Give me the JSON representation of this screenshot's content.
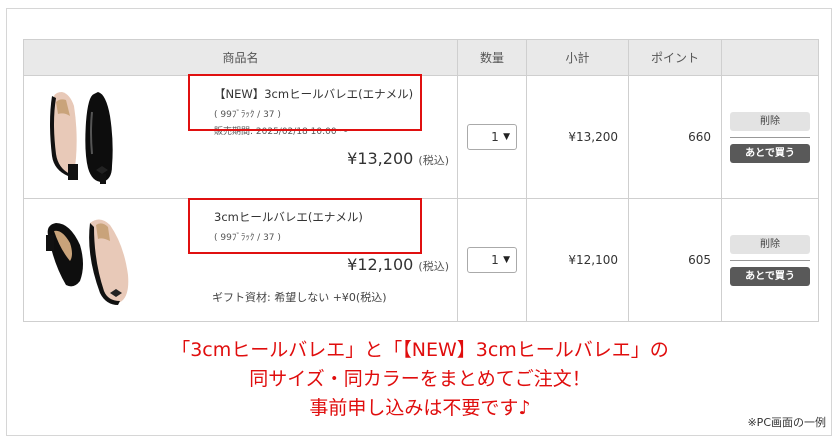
{
  "table": {
    "headers": [
      "商品名",
      "数量",
      "小計",
      "ポイント",
      ""
    ]
  },
  "items": [
    {
      "name": "【NEW】3cmヒールバレエ(エナメル)",
      "variant": "( 99ﾌﾞﾗｯｸ / 37 )",
      "period": "販売期間: 2025/02/18 10:00 ～",
      "price": "¥13,200",
      "tax": "(税込)",
      "qty": "1",
      "subtotal": "¥13,200",
      "points": "660",
      "delete_label": "削除",
      "later_label": "あとで買う"
    },
    {
      "name": "3cmヒールバレエ(エナメル)",
      "variant": "( 99ﾌﾞﾗｯｸ / 37 )",
      "price": "¥12,100",
      "tax": "(税込)",
      "gift": "ギフト資材: 希望しない +¥0(税込)",
      "qty": "1",
      "subtotal": "¥12,100",
      "points": "605",
      "delete_label": "削除",
      "later_label": "あとで買う"
    }
  ],
  "promo": {
    "line1": "「3cmヒールバレエ」と「【NEW】3cmヒールバレエ」の",
    "line2": "同サイズ・同カラーをまとめてご注文！",
    "line3": "事前申し込みは不要です♪"
  },
  "note": "※PC画面の一例",
  "colors": {
    "highlight": "#e01010",
    "header_bg": "#e9e9e9",
    "later_button": "#595959"
  }
}
